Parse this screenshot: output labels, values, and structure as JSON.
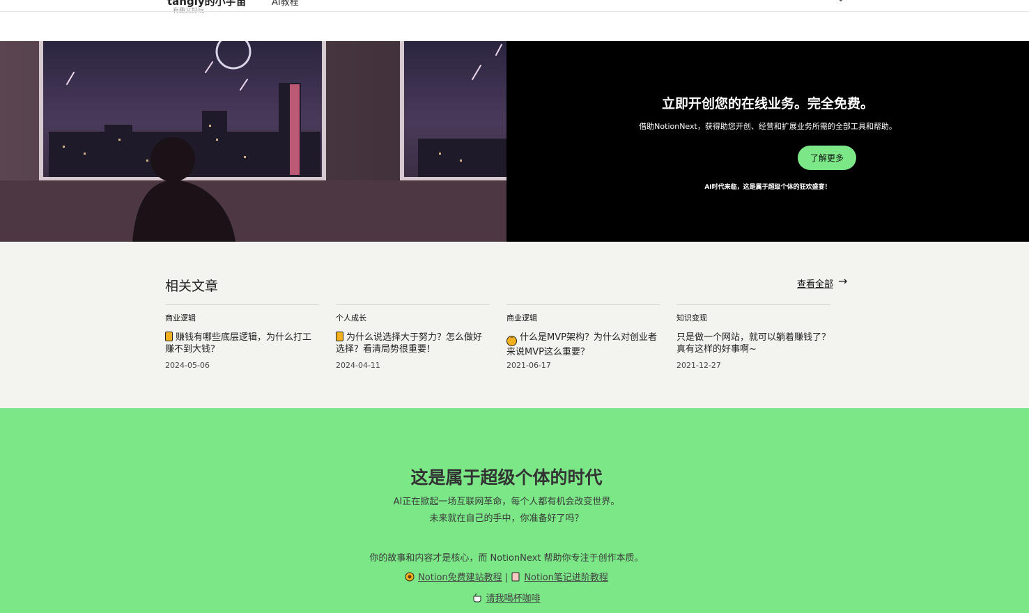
{
  "header": {
    "logo": "tangly的小宇宙",
    "subtitle": "有趣又好玩",
    "nav_item": "AI教程",
    "chevron_icon": "chevron-down-icon"
  },
  "hero": {
    "image_alt": "night-city-window-illustration",
    "title": "立即开创您的在线业务。完全免费。",
    "description": "借助NotionNext，获得助您开创、经营和扩展业务所需的全部工具和帮助。",
    "cta_label": "了解更多",
    "note": "AI时代来临，这是属于超级个体的狂欢盛宴！",
    "cta_color": "#7be787"
  },
  "related": {
    "title": "相关文章",
    "view_all": "查看全部",
    "arrow_icon": "arrow-right-icon",
    "cards": [
      {
        "category": "商业逻辑",
        "icon": "folder-icon",
        "title": "赚钱有哪些底层逻辑，为什么打工赚不到大钱？",
        "date": "2024-05-06"
      },
      {
        "category": "个人成长",
        "icon": "folder-icon",
        "title": "为什么说选择大于努力？怎么做好选择？看清局势很重要！",
        "date": "2024-04-11"
      },
      {
        "category": "商业逻辑",
        "icon": "thinking-face-icon",
        "title": "什么是MVP架构？为什么对创业者来说MVP这么重要？",
        "date": "2021-06-17"
      },
      {
        "category": "知识变现",
        "icon": "",
        "title": "只是做一个网站，就可以躺着赚钱了？真有这样的好事啊~",
        "date": "2021-12-27"
      }
    ]
  },
  "band": {
    "title": "这是属于超级个体的时代",
    "line1": "AI正在掀起一场互联网革命，每个人都有机会改变世界。",
    "line2": "未来就在自己的手中，你准备好了吗？",
    "line3": "你的故事和内容才是核心，而 NotionNext 帮助你专注于创作本质。",
    "link1": "Notion免费建站教程",
    "separator": "|",
    "link2": "Notion笔记进阶教程",
    "coffee": "请我喝杯咖啡",
    "background": "#7be787"
  }
}
